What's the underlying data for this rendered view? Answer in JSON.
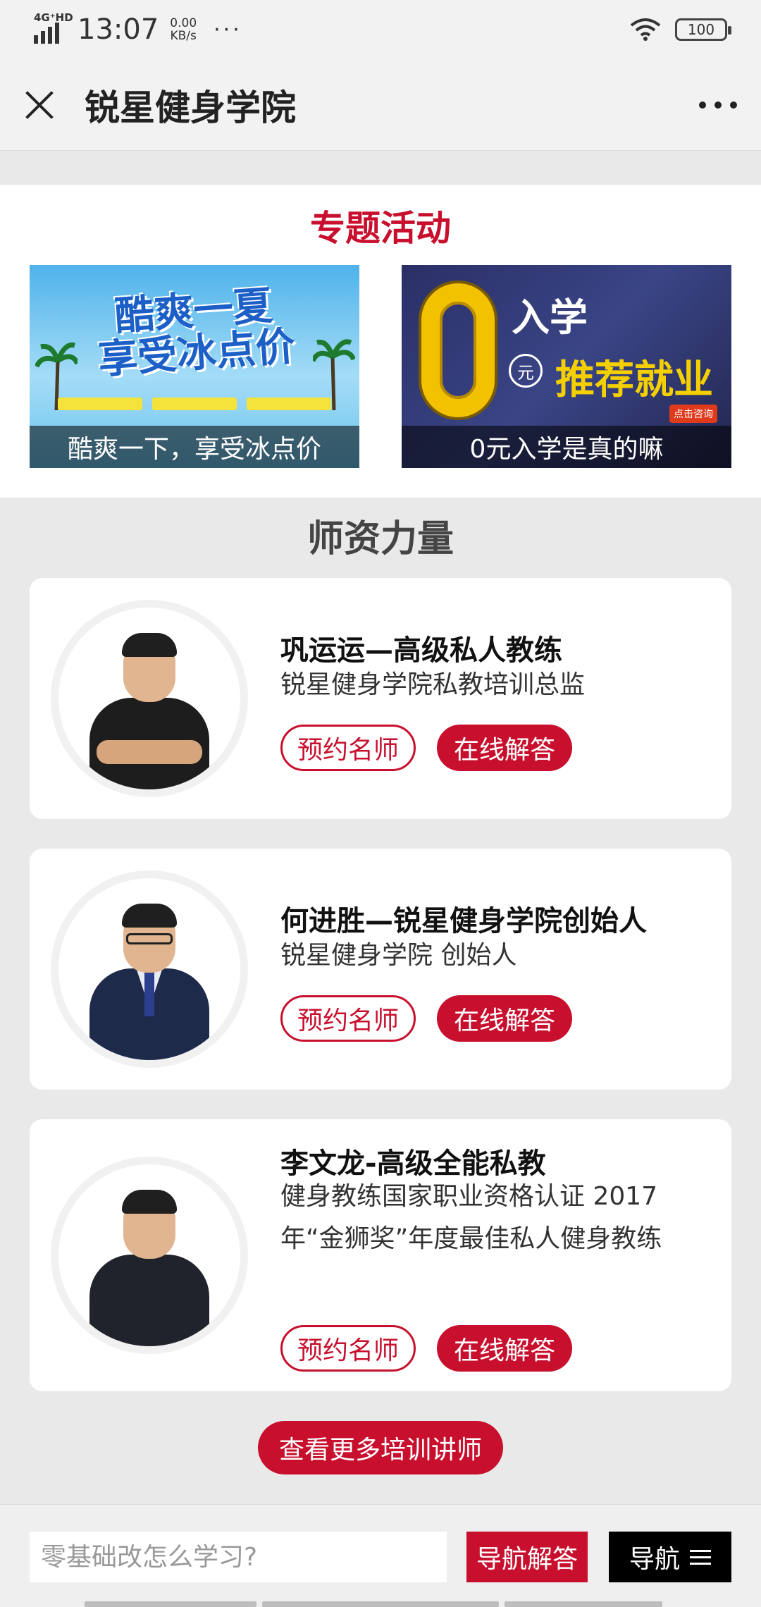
{
  "status_bar": {
    "network": "4G⁺HD",
    "time": "13:07",
    "speed_value": "0.00",
    "speed_unit": "KB/s",
    "more": "···",
    "battery": "100"
  },
  "nav": {
    "title": "锐星健身学院"
  },
  "topic": {
    "title": "专题活动",
    "banners": [
      {
        "caption": "酷爽一下，享受冰点价",
        "headline_1": "酷爽一夏",
        "headline_2": "享受冰点价"
      },
      {
        "caption": "0元入学是真的嘛",
        "text_1": "入学",
        "yuan": "元",
        "text_2": "推荐就业",
        "badge": "点击咨询"
      }
    ]
  },
  "faculty": {
    "title": "师资力量",
    "book_label": "预约名师",
    "answer_label": "在线解答",
    "teachers": [
      {
        "name": "巩运运—高级私人教练",
        "desc": "锐星健身学院私教培训总监"
      },
      {
        "name": "何进胜—锐星健身学院创始人",
        "desc": "锐星健身学院 创始人"
      },
      {
        "name": "李文龙-高级全能私教",
        "desc": "健身教练国家职业资格认证 2017年“金狮奖”年度最佳私人健身教练"
      }
    ],
    "more_label": "查看更多培训讲师"
  },
  "bottom": {
    "input_placeholder": "零基础改怎么学习?",
    "nav_answer_label": "导航解答",
    "nav_menu_label": "导航"
  },
  "colors": {
    "accent": "#c8102e",
    "background": "#e9e9e9"
  }
}
